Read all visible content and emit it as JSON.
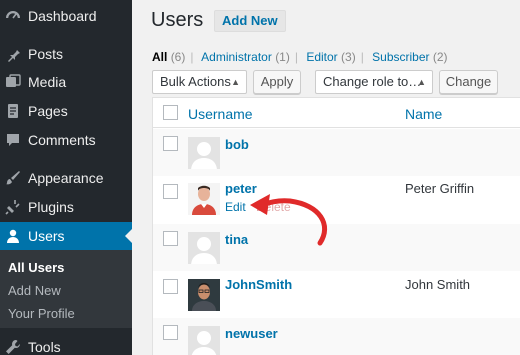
{
  "sidebar": {
    "items": [
      {
        "label": "Dashboard",
        "icon": "dashboard-icon"
      },
      {
        "label": "Posts",
        "icon": "pushpin-icon"
      },
      {
        "label": "Media",
        "icon": "media-icon"
      },
      {
        "label": "Pages",
        "icon": "pages-icon"
      },
      {
        "label": "Comments",
        "icon": "comment-icon"
      },
      {
        "label": "Appearance",
        "icon": "paintbrush-icon"
      },
      {
        "label": "Plugins",
        "icon": "plug-icon"
      },
      {
        "label": "Users",
        "icon": "user-icon"
      },
      {
        "label": "Tools",
        "icon": "wrench-icon"
      }
    ],
    "submenu": [
      "All Users",
      "Add New",
      "Your Profile"
    ]
  },
  "header": {
    "title": "Users",
    "add_new": "Add New"
  },
  "filters": [
    {
      "label": "All",
      "count": "(6)"
    },
    {
      "label": "Administrator",
      "count": "(1)"
    },
    {
      "label": "Editor",
      "count": "(3)"
    },
    {
      "label": "Subscriber",
      "count": "(2)"
    }
  ],
  "toolbar": {
    "bulk_actions": "Bulk Actions",
    "apply": "Apply",
    "change_role": "Change role to…",
    "change": "Change"
  },
  "table": {
    "columns": [
      "Username",
      "Name"
    ],
    "rows": [
      {
        "username": "bob",
        "name": ""
      },
      {
        "username": "peter",
        "name": "Peter Griffin",
        "action": "Edit",
        "action2": "Delete"
      },
      {
        "username": "tina",
        "name": ""
      },
      {
        "username": "JohnSmith",
        "name": "John Smith"
      },
      {
        "username": "newuser",
        "name": ""
      }
    ]
  },
  "colors": {
    "sidebar_bg": "#23282d",
    "active_bg": "#0073aa",
    "link": "#0073aa",
    "arrow": "#e02a2a"
  }
}
